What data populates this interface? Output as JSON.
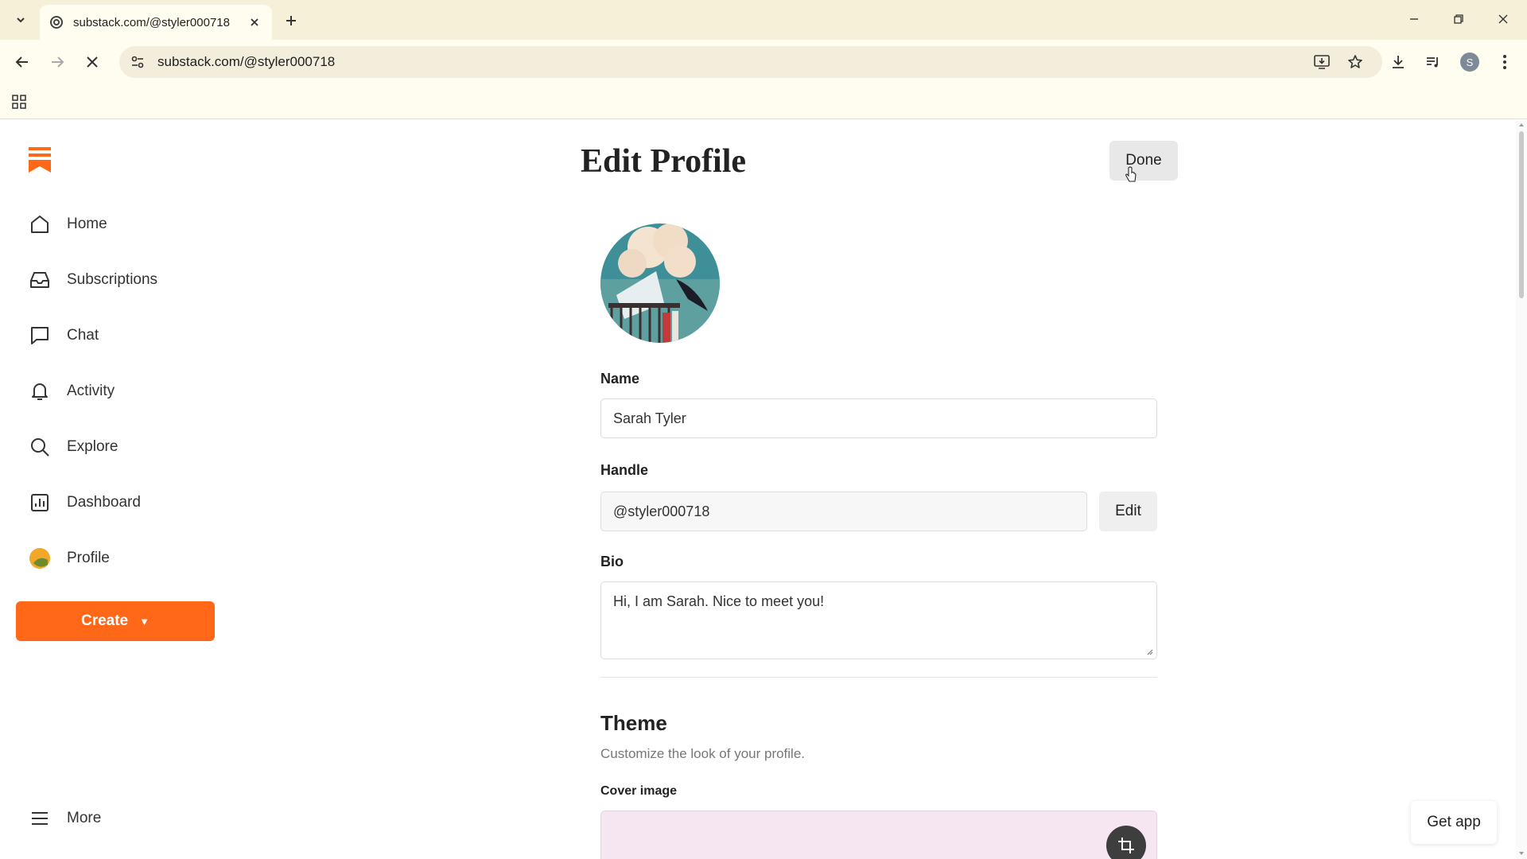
{
  "browser": {
    "tab_title": "substack.com/@styler000718",
    "url": "substack.com/@styler000718",
    "account_initial": "S"
  },
  "sidebar": {
    "items": [
      {
        "label": "Home",
        "icon": "home-icon"
      },
      {
        "label": "Subscriptions",
        "icon": "inbox-icon"
      },
      {
        "label": "Chat",
        "icon": "chat-icon"
      },
      {
        "label": "Activity",
        "icon": "bell-icon"
      },
      {
        "label": "Explore",
        "icon": "search-icon"
      },
      {
        "label": "Dashboard",
        "icon": "bar-chart-icon"
      },
      {
        "label": "Profile",
        "icon": "profile-avatar-icon"
      }
    ],
    "create_label": "Create",
    "more_label": "More"
  },
  "main": {
    "title": "Edit Profile",
    "done_label": "Done",
    "name_label": "Name",
    "name_value": "Sarah Tyler",
    "handle_label": "Handle",
    "handle_value": "@styler000718",
    "handle_edit_label": "Edit",
    "bio_label": "Bio",
    "bio_value": "Hi, I am Sarah. Nice to meet you!",
    "theme_title": "Theme",
    "theme_subtitle": "Customize the look of your profile.",
    "cover_label": "Cover image"
  },
  "get_app_label": "Get app",
  "colors": {
    "brand": "#ff6719",
    "browser_frame": "#f6f0d8",
    "cover_bg": "#f6e6f2"
  }
}
